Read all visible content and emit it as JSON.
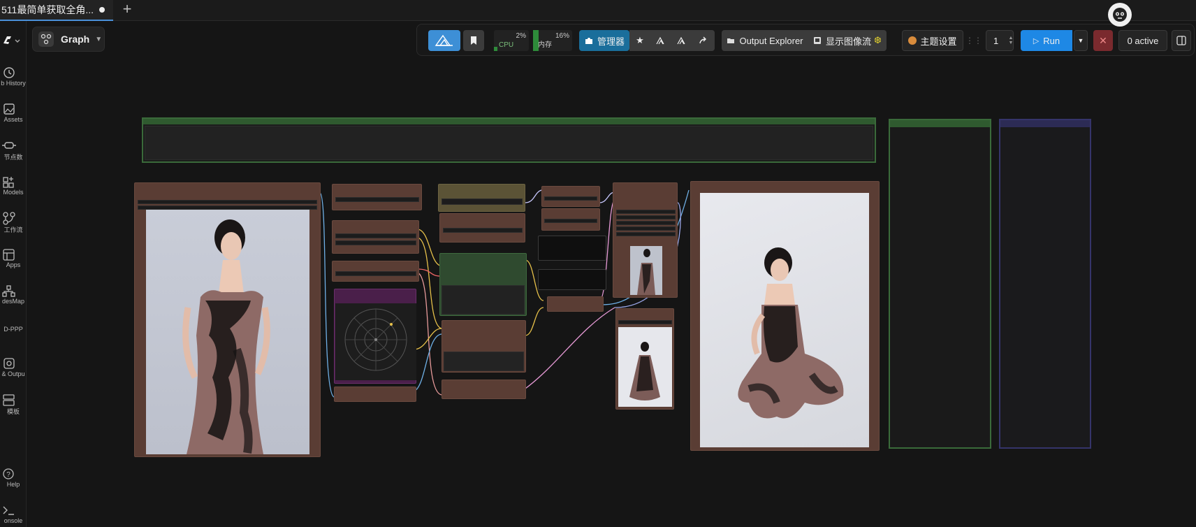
{
  "tab": {
    "title": "511最简单获取全角...",
    "add_label": "+"
  },
  "sidebar": {
    "logo": "C",
    "items": [
      {
        "icon": "history-icon",
        "label": "b History"
      },
      {
        "icon": "image-icon",
        "label": "Assets"
      },
      {
        "icon": "node-icon",
        "label": "节点数"
      },
      {
        "icon": "models-icon",
        "label": "Models"
      },
      {
        "icon": "workflow-icon",
        "label": "工作流"
      },
      {
        "icon": "apps-icon",
        "label": "Apps"
      },
      {
        "icon": "nodesmap-icon",
        "label": "desMap"
      },
      {
        "icon": "dppp-icon",
        "label": "D-PPP"
      },
      {
        "icon": "output-icon",
        "label": "& Outpu"
      },
      {
        "icon": "template-icon",
        "label": "模板"
      },
      {
        "icon": "help-icon",
        "label": "Help"
      },
      {
        "icon": "console-icon",
        "label": "onsole"
      }
    ]
  },
  "graph_selector": {
    "label": "Graph"
  },
  "toolbar": {
    "cpu_label": "CPU",
    "cpu_percent": "2%",
    "mem_label": "内存",
    "mem_percent": "16%",
    "manager_label": "管理器",
    "output_explorer_label": "Output Explorer",
    "image_stream_label": "显示图像流",
    "theme_label": "主题设置",
    "queue_count": "1",
    "run_label": "Run",
    "active_label": "0 active"
  },
  "colors": {
    "accent_blue": "#1e88e5",
    "node_brown": "#5a3d34",
    "group_green": "#3a7a3a",
    "group_purple": "#3c3a7a"
  }
}
